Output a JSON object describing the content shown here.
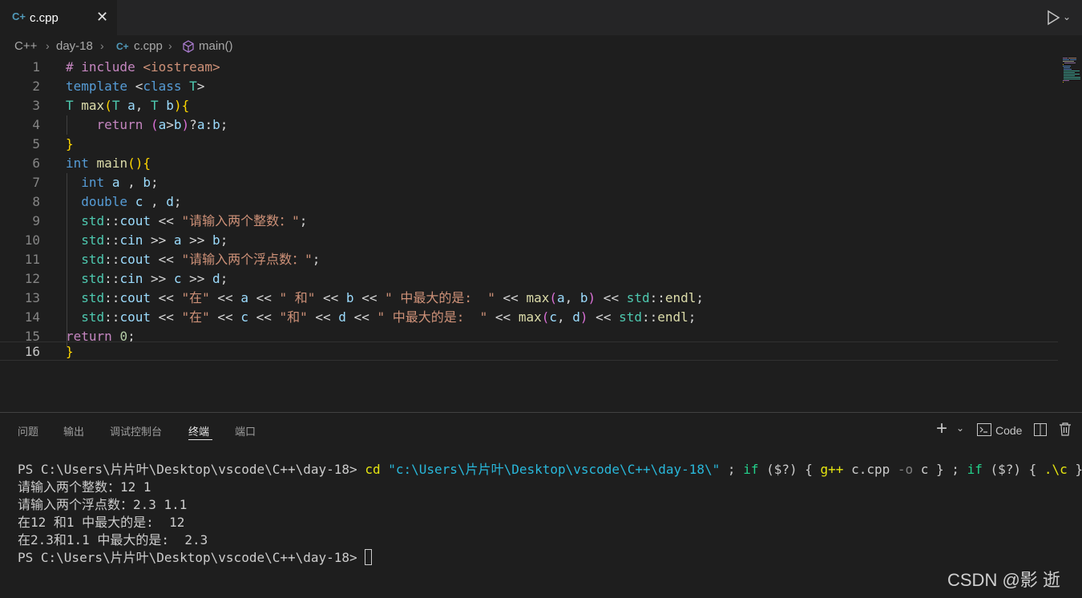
{
  "tab": {
    "icon": "cpp-file-icon",
    "label": "c.cpp",
    "close": "✕"
  },
  "toolbar": {
    "run": "run-icon",
    "chevron": "chevron-down-icon"
  },
  "breadcrumb": {
    "items": [
      "C++",
      "day-18",
      "c.cpp",
      "main()"
    ],
    "icons": [
      "folder",
      "folder",
      "cpp-file-icon",
      "cube-icon"
    ]
  },
  "editor": {
    "active_line": 16,
    "line_numbers": [
      "1",
      "2",
      "3",
      "4",
      "5",
      "6",
      "7",
      "8",
      "9",
      "10",
      "11",
      "12",
      "13",
      "14",
      "15",
      "16"
    ],
    "lines": [
      "# include <iostream>",
      "template <class T>",
      "T max(T a, T b){",
      "    return (a>b)?a:b;",
      "}",
      "int main(){",
      "  int a , b;",
      "  double c , d;",
      "  std::cout << \"请输入两个整数：\";",
      "  std::cin >> a >> b;",
      "  std::cout << \"请输入两个浮点数：\";",
      "  std::cin >> c >> d;",
      "  std::cout << \"在\" << a << \" 和\" << b << \" 中最大的是:  \" << max(a, b) << std::endl;",
      "  std::cout << \"在\" << c << \"和\" << d << \" 中最大的是:  \" << max(c, d) << std::endl;",
      "return 0;",
      "}"
    ]
  },
  "panel": {
    "tabs": [
      "问题",
      "输出",
      "调试控制台",
      "终端",
      "端口"
    ],
    "active_tab": "终端",
    "tools": {
      "add": "+",
      "add_chevron": "chevron-down-icon",
      "code_label": "Code",
      "split": "split-icon",
      "trash": "trash-icon"
    }
  },
  "terminal": {
    "prompt": "PS C:\\Users\\片片叶\\Desktop\\vscode\\C++\\day-18> ",
    "command": {
      "cd": "cd",
      "path": "\"c:\\Users\\片片叶\\Desktop\\vscode\\C++\\day-18\\\"",
      "rest1": " ; ",
      "if1": "if",
      "cond1": " ($?) { ",
      "gpp": "g++",
      "args": " c.cpp ",
      "flag": "-o",
      "tail1": " c } ; ",
      "if2": "if",
      "cond2": " ($?) { ",
      "exec": ".\\c",
      "tail2": " }"
    },
    "output": [
      "请输入两个整数：12 1",
      "请输入两个浮点数：2.3 1.1",
      "在12 和1 中最大的是:  12",
      "在2.3和1.1 中最大的是:  2.3"
    ],
    "final_prompt": "PS C:\\Users\\片片叶\\Desktop\\vscode\\C++\\day-18> "
  },
  "watermark": "CSDN @影 逝"
}
